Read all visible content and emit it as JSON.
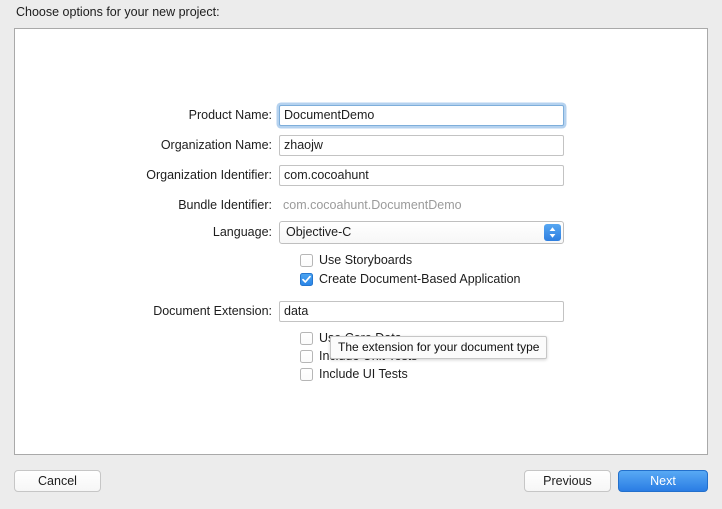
{
  "sheet": {
    "title": "Choose options for your new project:"
  },
  "form": {
    "fields": [
      {
        "label": "Product Name:",
        "value": "DocumentDemo",
        "type": "text",
        "focused": true,
        "name": "product-name"
      },
      {
        "label": "Organization Name:",
        "value": "zhaojw",
        "type": "text",
        "focused": false,
        "name": "organization-name"
      },
      {
        "label": "Organization Identifier:",
        "value": "com.cocoahunt",
        "type": "text",
        "focused": false,
        "name": "organization-identifier"
      },
      {
        "label": "Bundle Identifier:",
        "value": "com.cocoahunt.DocumentDemo",
        "type": "static",
        "focused": false,
        "name": "bundle-identifier"
      },
      {
        "label": "Language:",
        "value": "Objective-C",
        "type": "popup",
        "focused": false,
        "name": "language"
      },
      {
        "label": "Document Extension:",
        "value": "data",
        "type": "text",
        "focused": false,
        "name": "document-extension"
      }
    ],
    "checkboxes_upper": [
      {
        "label": "Use Storyboards",
        "checked": false,
        "name": "use-storyboards"
      },
      {
        "label": "Create Document-Based Application",
        "checked": true,
        "name": "create-document-based-application"
      }
    ],
    "checkboxes_lower": [
      {
        "label": "Use Core Data",
        "checked": false,
        "name": "use-core-data"
      },
      {
        "label": "Include Unit Tests",
        "checked": false,
        "name": "include-unit-tests"
      },
      {
        "label": "Include UI Tests",
        "checked": false,
        "name": "include-ui-tests"
      }
    ]
  },
  "tooltip": {
    "text": "The extension for your document type"
  },
  "buttons": {
    "cancel": "Cancel",
    "previous": "Previous",
    "next": "Next"
  },
  "colors": {
    "accent": "#2a7de4",
    "focus_ring": "#7eaeda",
    "window_background": "#ececec",
    "panel_background": "#ffffff",
    "static_text": "#9b9b9b"
  }
}
